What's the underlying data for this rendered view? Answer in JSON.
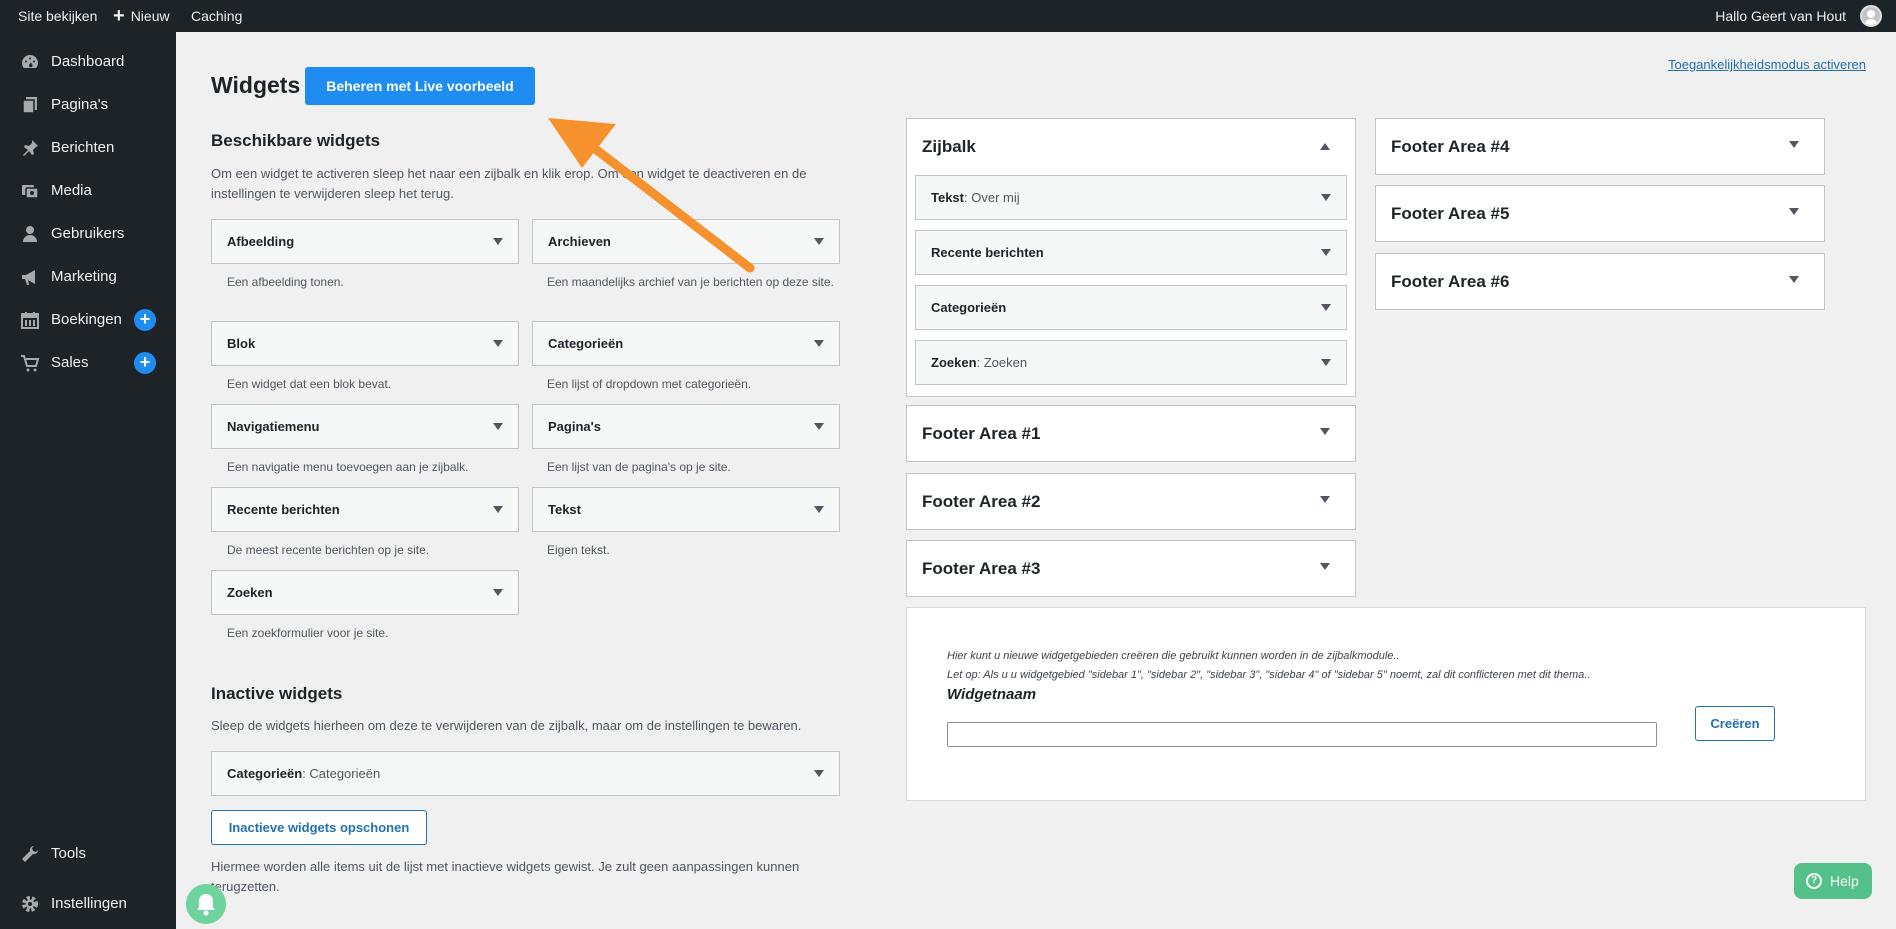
{
  "adminbar": {
    "site_view": "Site bekijken",
    "new": "Nieuw",
    "caching": "Caching",
    "greeting": "Hallo Geert van Hout"
  },
  "sidebar": {
    "items": [
      {
        "label": "Dashboard",
        "icon": "dashboard-icon"
      },
      {
        "label": "Pagina's",
        "icon": "pages-icon"
      },
      {
        "label": "Berichten",
        "icon": "pin-icon"
      },
      {
        "label": "Media",
        "icon": "media-icon"
      },
      {
        "label": "Gebruikers",
        "icon": "users-icon"
      },
      {
        "label": "Marketing",
        "icon": "megaphone-icon"
      },
      {
        "label": "Boekingen",
        "icon": "calendar-icon"
      },
      {
        "label": "Sales",
        "icon": "cart-icon"
      },
      {
        "label": "Tools",
        "icon": "wrench-icon"
      },
      {
        "label": "Instellingen",
        "icon": "gear-icon"
      }
    ],
    "badge": "+"
  },
  "header": {
    "title": "Widgets",
    "live_button": "Beheren met Live voorbeeld",
    "a11y_link": "Toegankelijkheidsmodus activeren"
  },
  "available": {
    "title": "Beschikbare widgets",
    "description": "Om een widget te activeren sleep het naar een zijbalk en klik erop. Om een widget te deactiveren en de instellingen te verwijderen sleep het terug.",
    "widgets": [
      {
        "name": "Afbeelding",
        "desc": "Een afbeelding tonen."
      },
      {
        "name": "Archieven",
        "desc": "Een maandelijks archief van je berichten op deze site."
      },
      {
        "name": "Blok",
        "desc": "Een widget dat een blok bevat."
      },
      {
        "name": "Categorieën",
        "desc": "Een lijst of dropdown met categorieën."
      },
      {
        "name": "Navigatiemenu",
        "desc": "Een navigatie menu toevoegen aan je zijbalk."
      },
      {
        "name": "Pagina's",
        "desc": "Een lijst van de pagina's op je site."
      },
      {
        "name": "Recente berichten",
        "desc": "De meest recente berichten op je site."
      },
      {
        "name": "Tekst",
        "desc": "Eigen tekst."
      },
      {
        "name": "Zoeken",
        "desc": "Een zoekformulier voor je site."
      }
    ]
  },
  "inactive": {
    "title": "Inactive widgets",
    "description": "Sleep de widgets hierheen om deze te verwijderen van de zijbalk, maar om de instellingen te bewaren.",
    "widget_name": "Categorieën",
    "widget_sub": ": Categorieën",
    "clear_button": "Inactieve widgets opschonen",
    "clear_note": "Hiermee worden alle items uit de lijst met inactieve widgets gewist. Je zult geen aanpassingen kunnen terugzetten."
  },
  "zijbalk": {
    "title": "Zijbalk",
    "widgets": [
      {
        "name": "Tekst",
        "sub": ": Over mij"
      },
      {
        "name": "Recente berichten",
        "sub": ""
      },
      {
        "name": "Categorieën",
        "sub": ""
      },
      {
        "name": "Zoeken",
        "sub": ": Zoeken"
      }
    ]
  },
  "areas": {
    "footer1": "Footer Area #1",
    "footer2": "Footer Area #2",
    "footer3": "Footer Area #3",
    "footer4": "Footer Area #4",
    "footer5": "Footer Area #5",
    "footer6": "Footer Area #6"
  },
  "create": {
    "note1": "Hier kunt u nieuwe widgetgebieden creëren die gebruikt kunnen worden in de zijbalkmodule..",
    "note2": "Let op: Als u u widgetgebied \"sidebar 1\", \"sidebar 2\", \"sidebar 3\", \"sidebar 4\" of \"sidebar 5\" noemt, zal dit conflicteren met dit thema..",
    "label": "Widgetnaam",
    "input_value": "",
    "button": "Creëren"
  },
  "help": {
    "label": "Help"
  },
  "colors": {
    "accent": "#1e8cf0",
    "arrow": "#f6922d",
    "admin_bg": "#1d2327",
    "help": "#54c18a"
  }
}
